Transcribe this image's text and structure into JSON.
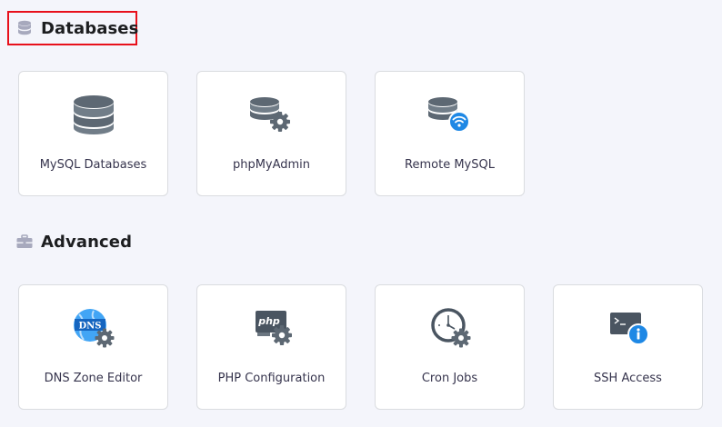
{
  "sections": {
    "databases": {
      "title": "Databases",
      "icon": "database-icon",
      "cards": [
        {
          "label": "MySQL Databases",
          "icon": "database-stack-icon"
        },
        {
          "label": "phpMyAdmin",
          "icon": "database-gear-icon"
        },
        {
          "label": "Remote MySQL",
          "icon": "database-wifi-icon"
        }
      ]
    },
    "advanced": {
      "title": "Advanced",
      "icon": "toolbox-icon",
      "cards": [
        {
          "label": "DNS Zone Editor",
          "icon": "dns-gear-icon"
        },
        {
          "label": "PHP Configuration",
          "icon": "php-gear-icon"
        },
        {
          "label": "Cron Jobs",
          "icon": "clock-gear-icon"
        },
        {
          "label": "SSH Access",
          "icon": "terminal-info-icon"
        }
      ]
    }
  },
  "colors": {
    "background": "#f4f5fb",
    "card_border": "#dadce0",
    "icon_dark": "#5d6873",
    "icon_blue": "#1e88e5",
    "highlight": "#e8101b"
  }
}
